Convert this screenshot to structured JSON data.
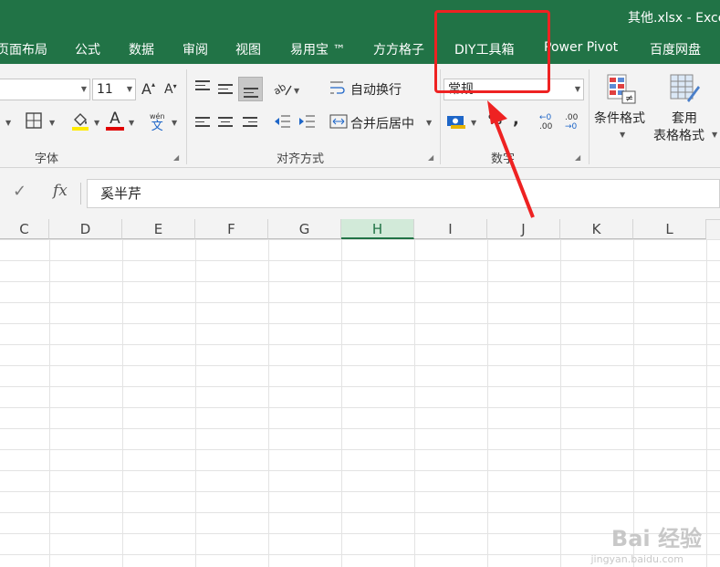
{
  "window": {
    "title": "其他.xlsx - Exce"
  },
  "tabs": [
    {
      "label": "页面布局"
    },
    {
      "label": "公式"
    },
    {
      "label": "数据"
    },
    {
      "label": "审阅"
    },
    {
      "label": "视图"
    },
    {
      "label": "易用宝 ™"
    },
    {
      "label": "方方格子"
    },
    {
      "label": "DIY工具箱"
    },
    {
      "label": "Power Pivot"
    },
    {
      "label": "百度网盘"
    }
  ],
  "ribbon": {
    "font": {
      "group_label": "字体",
      "font_size": "11",
      "grow_font": "A",
      "shrink_font": "A",
      "font_color_glyph": "A",
      "phonetic_top": "wén",
      "phonetic_bottom": "文"
    },
    "alignment": {
      "group_label": "对齐方式",
      "wrap_text": "自动换行",
      "merge_center": "合并后居中"
    },
    "number": {
      "group_label": "数字",
      "format_value": "常规",
      "comma_glyph": ",",
      "inc_decimal": ".00",
      "dec_decimal": ".00"
    },
    "styles": {
      "conditional_formatting": "条件格式",
      "format_as_table_line1": "套用",
      "format_as_table_line2": "表格格式"
    }
  },
  "formula_bar": {
    "enter_glyph": "✓",
    "fx_glyph": "fx",
    "content": "奚半芹"
  },
  "grid": {
    "columns": [
      "C",
      "D",
      "E",
      "F",
      "G",
      "H",
      "I",
      "J",
      "K",
      "L"
    ],
    "selected_column": "H"
  },
  "colors": {
    "brand": "#217346",
    "annotation": "#ee2222"
  },
  "watermark": {
    "main": "Bai 经验",
    "sub": "jingyan.baidu.com"
  }
}
